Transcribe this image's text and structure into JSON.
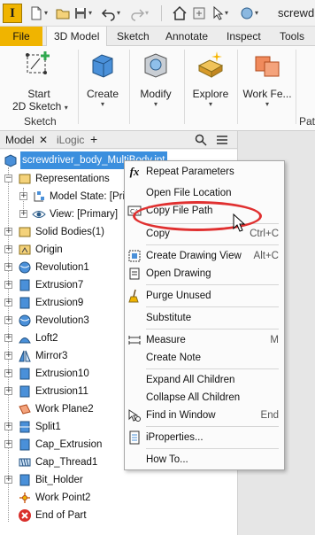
{
  "app": {
    "logo_letter": "I",
    "title": "screwdr"
  },
  "ribbon_tabs": [
    "File",
    "3D Model",
    "Sketch",
    "Annotate",
    "Inspect",
    "Tools"
  ],
  "ribbon": {
    "start_sketch": "Start",
    "start_sketch_2": "2D Sketch",
    "create": "Create",
    "modify": "Modify",
    "explore": "Explore",
    "work_features": "Work Fe...",
    "sketch_panel": "Sketch",
    "pattern_panel": "Patt"
  },
  "browser": {
    "tab_model": "Model",
    "tab_ilogic": "iLogic",
    "add_tab": "+"
  },
  "tree": {
    "root": "screwdriver_body_MultiBody.ipt",
    "items": [
      "Representations",
      "Model State: [Primary]",
      "View: [Primary]",
      "Solid Bodies(1)",
      "Origin",
      "Revolution1",
      "Extrusion7",
      "Extrusion9",
      "Revolution3",
      "Loft2",
      "Mirror3",
      "Extrusion10",
      "Extrusion11",
      "Work Plane2",
      "Split1",
      "Cap_Extrusion",
      "Cap_Thread1",
      "Bit_Holder",
      "Work Point2",
      "End of Part"
    ]
  },
  "context_menu": {
    "repeat_parameters": "Repeat Parameters",
    "open_file_location": "Open File Location",
    "copy_file_path": "Copy File Path",
    "copy": "Copy",
    "copy_shortcut": "Ctrl+C",
    "create_drawing_view": "Create Drawing View",
    "create_drawing_view_shortcut": "Alt+C",
    "open_drawing": "Open Drawing",
    "purge_unused": "Purge Unused",
    "substitute": "Substitute",
    "measure": "Measure",
    "measure_shortcut": "M",
    "create_note": "Create Note",
    "expand_all_children": "Expand All Children",
    "collapse_all_children": "Collapse All Children",
    "find_in_window": "Find in Window",
    "find_in_window_shortcut": "End",
    "iproperties": "iProperties...",
    "how_to": "How To..."
  },
  "colors": {
    "accent_yellow": "#f0b400",
    "selection_blue": "#3b8fde",
    "annotation_red": "#e03030",
    "part_blue": "#4a90d9"
  }
}
